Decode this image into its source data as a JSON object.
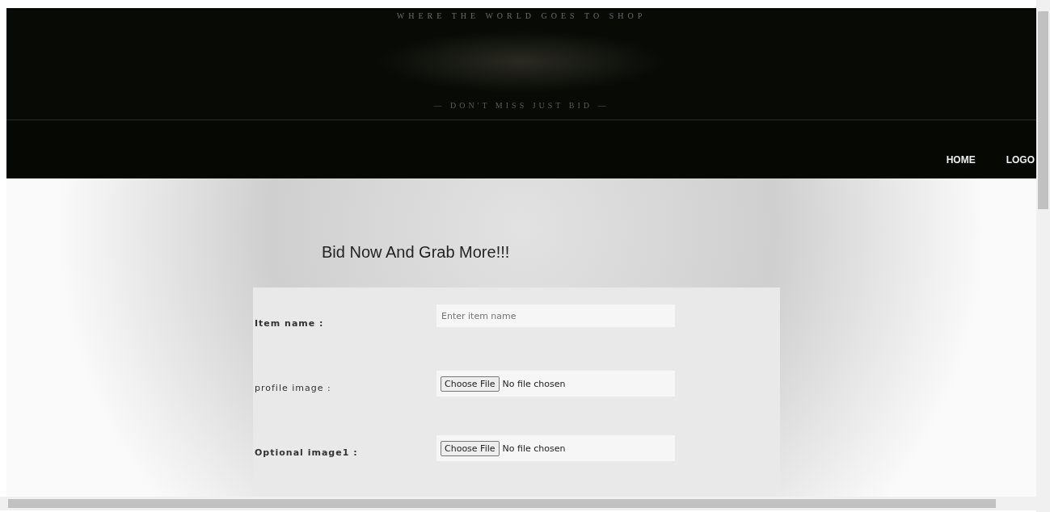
{
  "banner": {
    "tagline": "WHERE THE WORLD GOES TO SHOP",
    "slogan": "— DON'T MISS JUST BID —"
  },
  "nav": [
    {
      "label": "HOME"
    },
    {
      "label": "LOGO"
    }
  ],
  "heading": "Bid Now And Grab More!!!",
  "form": {
    "fields": [
      {
        "kind": "text",
        "label": "Item name :",
        "placeholder": "Enter item name"
      },
      {
        "kind": "file",
        "label": "profile image :",
        "button": "Choose File",
        "status": "No file chosen"
      },
      {
        "kind": "file",
        "label": "Optional image1 :",
        "button": "Choose File",
        "status": "No file chosen"
      }
    ]
  }
}
